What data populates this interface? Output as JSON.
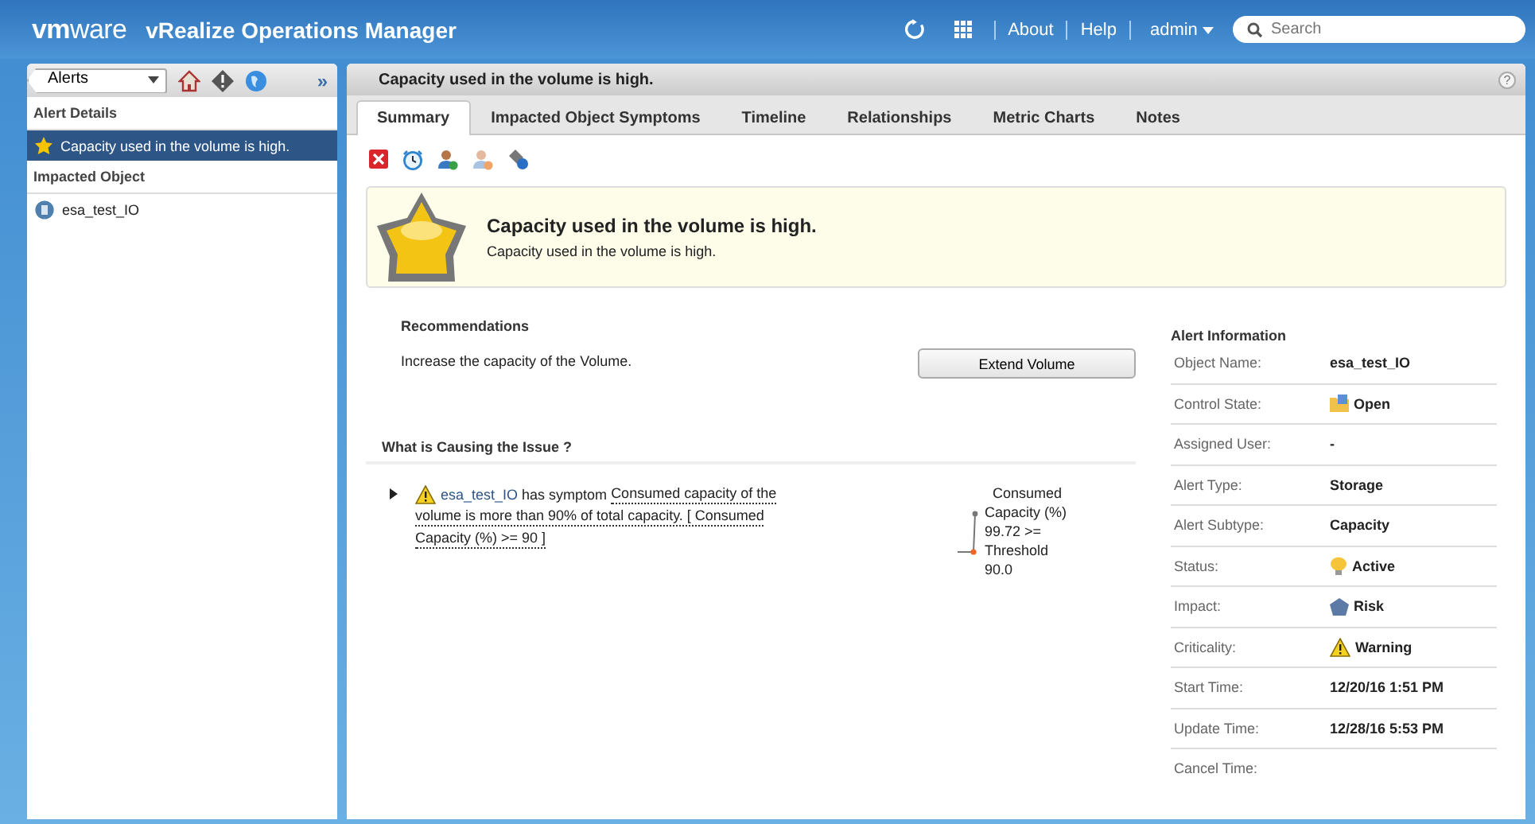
{
  "header": {
    "logo": "**vm**ware",
    "title": "vRealize Operations Manager",
    "links": [
      "About",
      "Help"
    ],
    "user": "admin",
    "search": {
      "placeholder": "Search"
    }
  },
  "sidebar": {
    "dropdown": "Alerts",
    "expand": "»",
    "sections": [
      {
        "heading": "Alert Details",
        "items": [
          {
            "label": "Capacity used in the volume is high.",
            "kind": "alert",
            "selected": true
          }
        ]
      },
      {
        "heading": "Impacted Object",
        "items": [
          {
            "label": "esa_test_IO",
            "kind": "object",
            "selected": false
          }
        ]
      }
    ]
  },
  "main": {
    "title": "Capacity used in the volume is high.",
    "help": "?",
    "tabs": [
      {
        "label": "Summary",
        "selected": true
      },
      {
        "label": "Impacted Object Symptoms",
        "selected": false
      },
      {
        "label": "Timeline",
        "selected": false
      },
      {
        "label": "Relationships",
        "selected": false
      },
      {
        "label": "Metric Charts",
        "selected": false
      },
      {
        "label": "Notes",
        "selected": false
      }
    ],
    "banner": {
      "title": "Capacity used in the volume is high.",
      "description": "Capacity used in the volume is high."
    },
    "recommendations": {
      "heading": "Recommendations",
      "text": "Increase the capacity of the Volume.",
      "button": "Extend Volume"
    },
    "cause": {
      "heading": "What is Causing the Issue ?",
      "expanded": false,
      "object": "esa_test_IO",
      "middle": " has symptom ",
      "symptom_lines": [
        "Consumed capacity of the",
        "volume is more than 90% of total capacity. [ Consumed",
        "Capacity (%) >= 90 ]"
      ],
      "reading": [
        "Consumed",
        "Capacity (%)",
        "99.72 >=",
        "Threshold",
        "90.0"
      ]
    },
    "info": {
      "heading": "Alert Information",
      "rows": [
        {
          "label": "Object Name:",
          "value": "esa_test_IO"
        },
        {
          "label": "Control State:",
          "value": "Open",
          "kind": "state"
        },
        {
          "label": "Assigned User:",
          "value": "-"
        },
        {
          "label": "Alert Type:",
          "value": "Storage"
        },
        {
          "label": "Alert Subtype:",
          "value": "Capacity"
        },
        {
          "label": "Status:",
          "value": "Active",
          "kind": "status"
        },
        {
          "label": "Impact:",
          "value": "Risk",
          "kind": "impact"
        },
        {
          "label": "Criticality:",
          "value": "Warning",
          "kind": "criticality"
        },
        {
          "label": "Start Time:",
          "value": "12/20/16 1:51 PM"
        },
        {
          "label": "Update Time:",
          "value": "12/28/16 5:53 PM"
        },
        {
          "label": "Cancel Time:"
        }
      ]
    }
  }
}
